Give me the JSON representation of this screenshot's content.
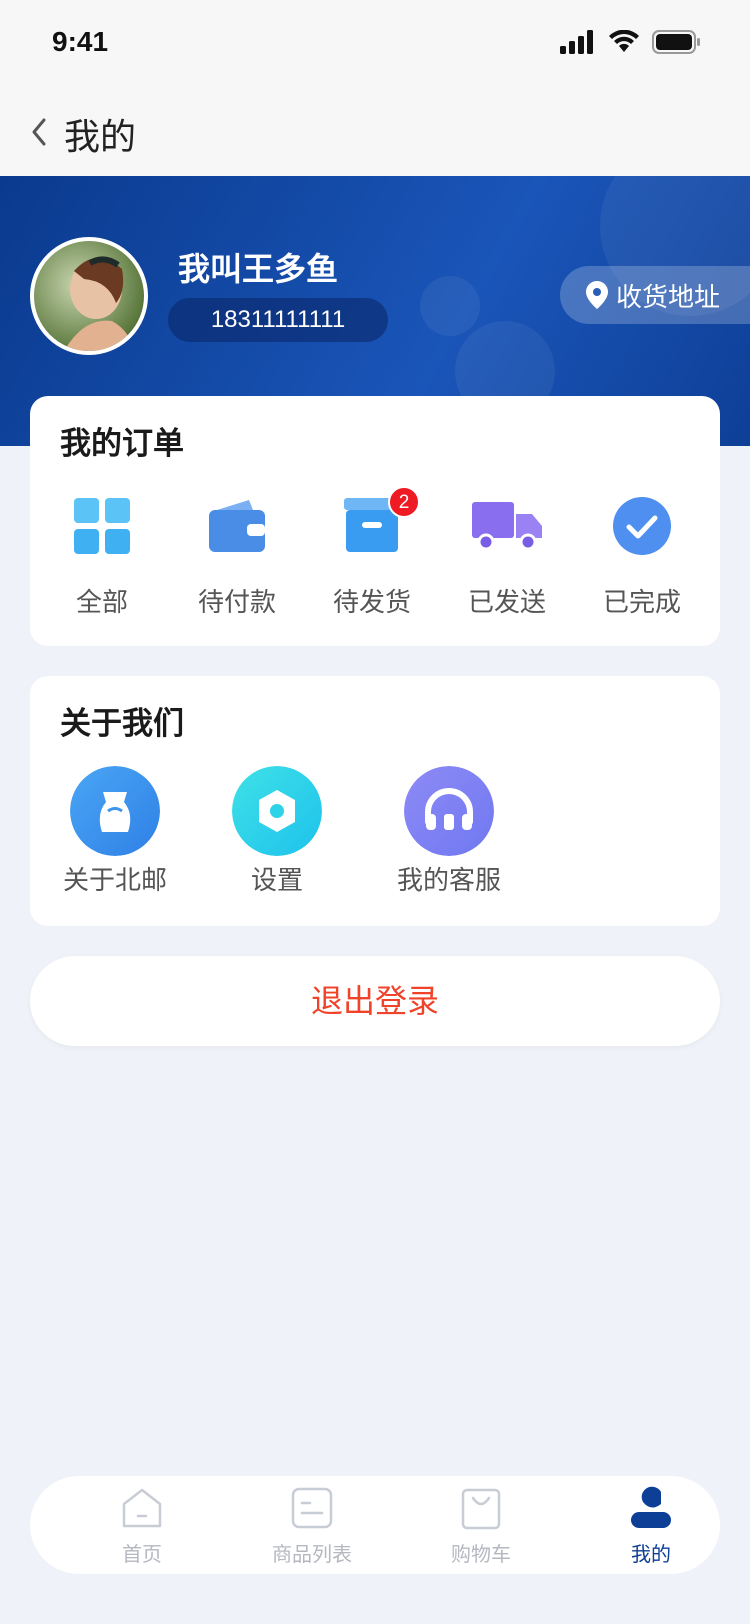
{
  "status_bar": {
    "time": "9:41"
  },
  "nav": {
    "title": "我的"
  },
  "user": {
    "name": "我叫王多鱼",
    "phone": "18311111111",
    "address_label": "收货地址"
  },
  "orders": {
    "title": "我的订单",
    "items": [
      {
        "label": "全部",
        "icon": "grid-icon",
        "color": "#4fb8f5"
      },
      {
        "label": "待付款",
        "icon": "wallet-icon",
        "color": "#4a8de6"
      },
      {
        "label": "待发货",
        "icon": "box-icon",
        "color": "#3a9cf0",
        "badge": "2"
      },
      {
        "label": "已发送",
        "icon": "truck-icon",
        "color": "#8a6ef0"
      },
      {
        "label": "已完成",
        "icon": "check-circle-icon",
        "color": "#4f8ff0"
      }
    ]
  },
  "about": {
    "title": "关于我们",
    "items": [
      {
        "label": "关于北邮",
        "icon": "about-icon",
        "color": "#3d96ee"
      },
      {
        "label": "设置",
        "icon": "settings-icon",
        "color": "#2ed3e8"
      },
      {
        "label": "我的客服",
        "icon": "headset-icon",
        "color": "#7e82f4"
      }
    ]
  },
  "logout": {
    "label": "退出登录",
    "color": "#f0442a"
  },
  "tabbar": {
    "items": [
      {
        "label": "首页",
        "icon": "home-icon",
        "active": false
      },
      {
        "label": "商品列表",
        "icon": "list-icon",
        "active": false
      },
      {
        "label": "购物车",
        "icon": "bag-icon",
        "active": false
      },
      {
        "label": "我的",
        "icon": "user-icon",
        "active": true
      }
    ],
    "active_color": "#0e3f97"
  }
}
